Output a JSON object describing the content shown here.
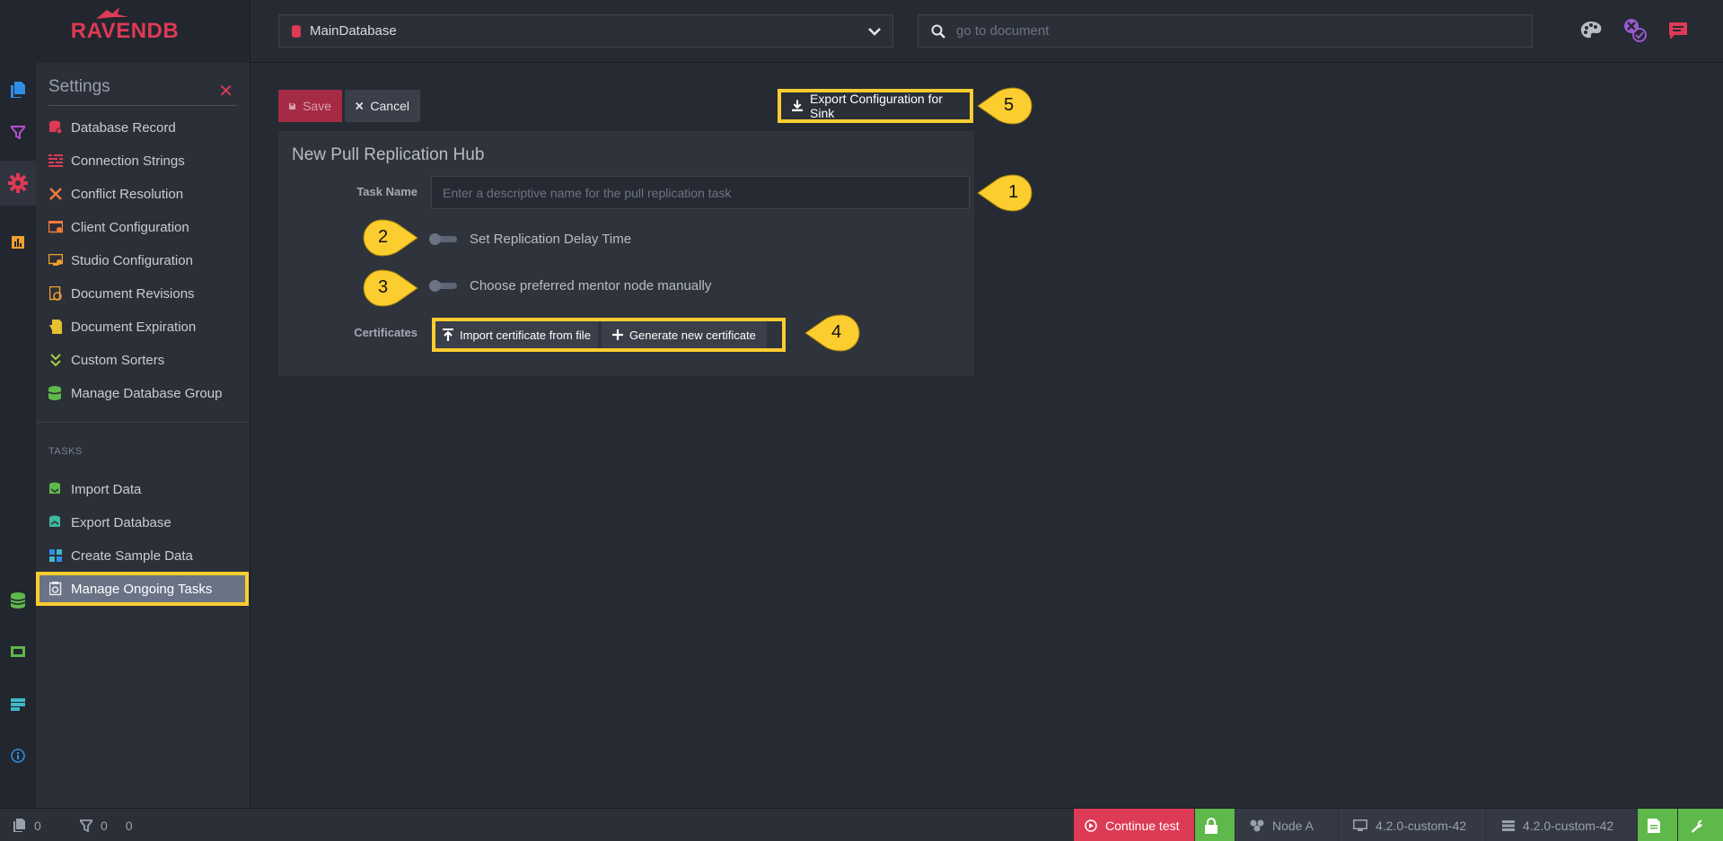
{
  "header": {
    "logo_text": "RAVENDB",
    "database": "MainDatabase",
    "search_placeholder": "go to document",
    "icons": [
      "palette-icon",
      "notifications-icon",
      "feedback-icon"
    ]
  },
  "left_strip": {
    "icons": [
      "documents-icon",
      "indexes-icon",
      "settings-icon",
      "stats-icon",
      "databases-icon",
      "manage-server-icon",
      "cluster-icon",
      "about-icon"
    ]
  },
  "settings_menu": {
    "title": "Settings",
    "items": [
      {
        "label": "Database Record",
        "icon": "database-record-icon"
      },
      {
        "label": "Connection Strings",
        "icon": "connection-strings-icon"
      },
      {
        "label": "Conflict Resolution",
        "icon": "conflict-icon"
      },
      {
        "label": "Client Configuration",
        "icon": "client-config-icon"
      },
      {
        "label": "Studio Configuration",
        "icon": "studio-config-icon"
      },
      {
        "label": "Document Revisions",
        "icon": "revisions-icon"
      },
      {
        "label": "Document Expiration",
        "icon": "expiration-icon"
      },
      {
        "label": "Custom Sorters",
        "icon": "sorters-icon"
      },
      {
        "label": "Manage Database Group",
        "icon": "db-group-icon"
      }
    ],
    "tasks_heading": "TASKS",
    "tasks": [
      {
        "label": "Import Data",
        "icon": "import-icon"
      },
      {
        "label": "Export Database",
        "icon": "export-icon"
      },
      {
        "label": "Create Sample Data",
        "icon": "sample-data-icon"
      },
      {
        "label": "Manage Ongoing Tasks",
        "icon": "ongoing-tasks-icon"
      }
    ]
  },
  "toolbar": {
    "save_label": "Save",
    "cancel_label": "Cancel",
    "export_label": "Export Configuration for Sink"
  },
  "form": {
    "title": "New Pull Replication Hub",
    "task_name_label": "Task Name",
    "task_name_placeholder": "Enter a descriptive name for the pull replication task",
    "delay_toggle_label": "Set Replication Delay Time",
    "mentor_toggle_label": "Choose preferred mentor node manually",
    "certificates_label": "Certificates",
    "import_cert_label": "Import certificate from file",
    "generate_cert_label": "Generate new certificate"
  },
  "callouts": [
    "1",
    "2",
    "3",
    "4",
    "5"
  ],
  "statusbar": {
    "docs_count": "0",
    "index_count_a": "0",
    "index_count_b": "0",
    "continue_label": "Continue test",
    "node_label": "Node A",
    "studio_version": "4.2.0-custom-42",
    "server_version": "4.2.0-custom-42"
  },
  "colors": {
    "brand": "#dd3a55",
    "highlight": "#fbcd2e",
    "success": "#5fb84a",
    "background": "#262a33"
  }
}
